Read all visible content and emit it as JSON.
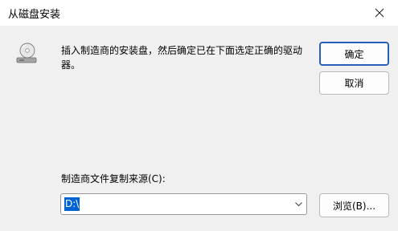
{
  "dialog": {
    "title": "从磁盘安装",
    "message": "插入制造商的安装盘，然后确定已在下面选定正确的驱动器。",
    "ok_label": "确定",
    "cancel_label": "取消",
    "source_label": "制造商文件复制来源(C):",
    "source_value": "D:\\",
    "browse_label": "浏览(B)...",
    "icons": {
      "disk": "disk-drive-icon",
      "close": "close-icon",
      "dropdown": "chevron-down-icon"
    }
  }
}
